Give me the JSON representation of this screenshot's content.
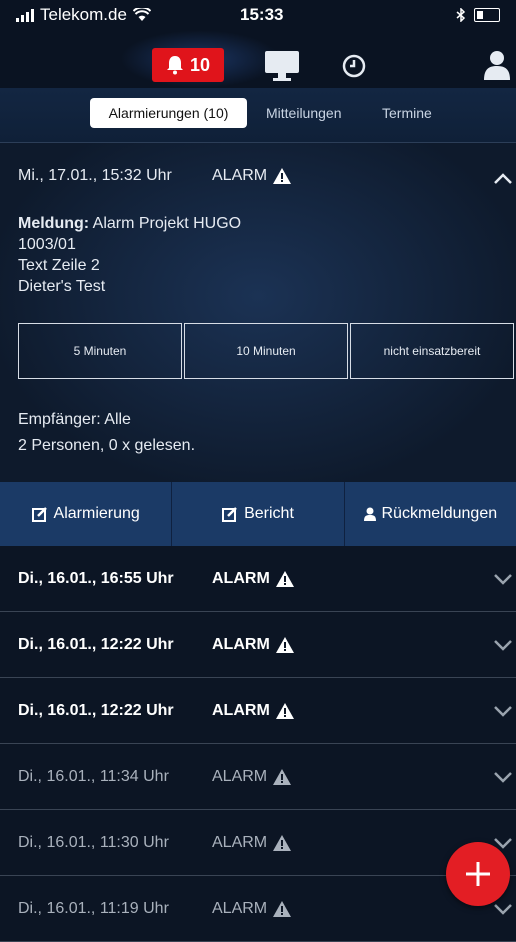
{
  "status": {
    "carrier": "Telekom.de",
    "time": "15:33"
  },
  "nav": {
    "alarm_count": "10"
  },
  "tabs": [
    {
      "label": "Alarmierungen (10)",
      "active": true
    },
    {
      "label": "Mitteilungen",
      "active": false
    },
    {
      "label": "Termine",
      "active": false
    }
  ],
  "expanded": {
    "date": "Mi., 17.01., 15:32 Uhr",
    "type": "ALARM",
    "message_label": "Meldung:",
    "message_text": "Alarm Projekt HUGO",
    "lines": [
      "1003/01",
      "Text Zeile 2",
      "Dieter's Test"
    ],
    "responses": [
      "5 Minuten",
      "10 Minuten",
      "nicht einsatzbereit"
    ],
    "recipients": "Empfänger: Alle",
    "read_status": "2 Personen, 0 x gelesen."
  },
  "actions": [
    "Alarmierung",
    "Bericht",
    "Rückmeldungen"
  ],
  "list": [
    {
      "date": "Di., 16.01., 16:55 Uhr",
      "type": "ALARM",
      "unread": true
    },
    {
      "date": "Di., 16.01., 12:22 Uhr",
      "type": "ALARM",
      "unread": true
    },
    {
      "date": "Di., 16.01., 12:22 Uhr",
      "type": "ALARM",
      "unread": true
    },
    {
      "date": "Di., 16.01., 11:34 Uhr",
      "type": "ALARM",
      "unread": false
    },
    {
      "date": "Di., 16.01., 11:30 Uhr",
      "type": "ALARM",
      "unread": false
    },
    {
      "date": "Di., 16.01., 11:19 Uhr",
      "type": "ALARM",
      "unread": false
    }
  ],
  "colors": {
    "accent": "#e31e24",
    "background": "#0c1524",
    "action_bar": "#1b3a66"
  }
}
